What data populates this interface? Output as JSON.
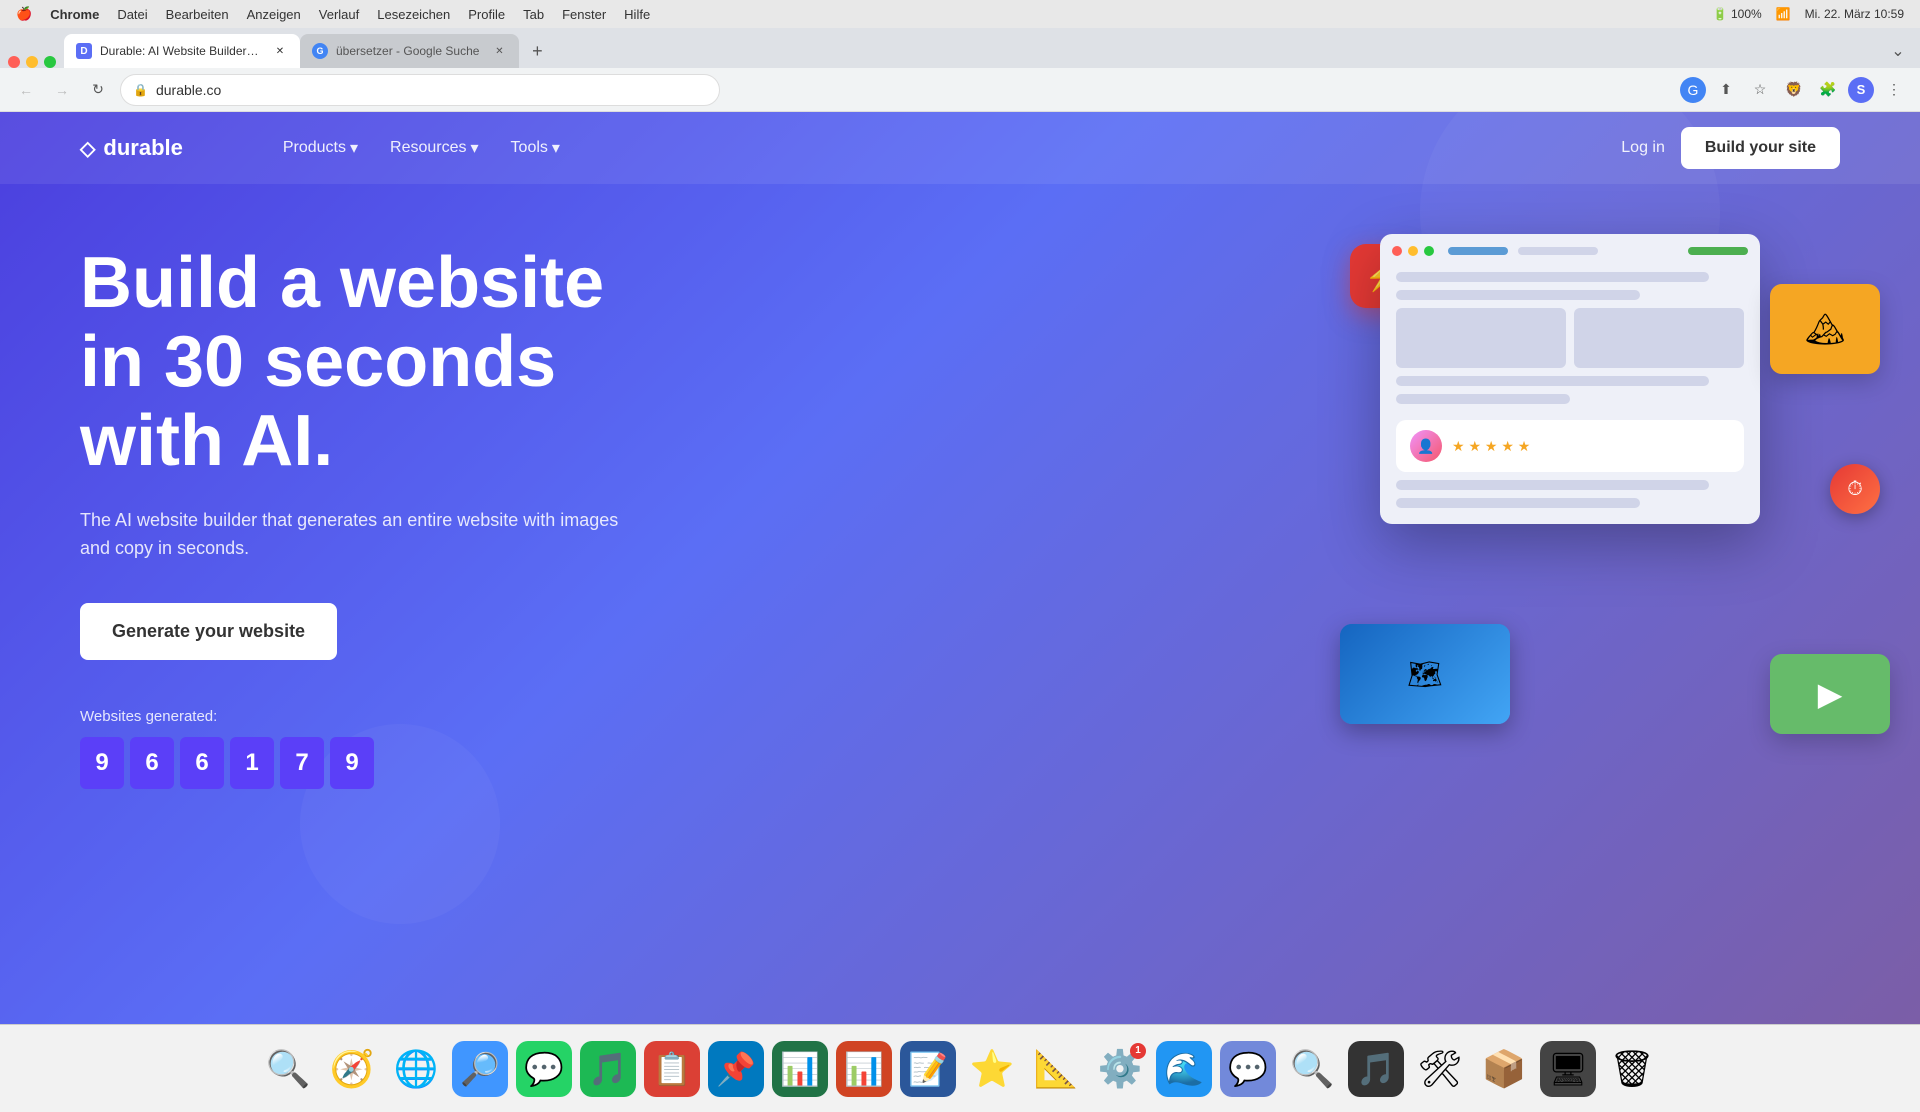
{
  "macos": {
    "apple": "🍎",
    "menu_items": [
      "Chrome",
      "Datei",
      "Bearbeiten",
      "Anzeigen",
      "Verlauf",
      "Lesezeichen",
      "Profile",
      "Tab",
      "Fenster",
      "Hilfe"
    ],
    "time": "Mi. 22. März  10:59"
  },
  "browser": {
    "tabs": [
      {
        "title": "Durable: AI Website Builder a...",
        "url": "durable.co",
        "active": true
      },
      {
        "title": "übersetzer - Google Suche",
        "url": "google.com",
        "active": false
      }
    ],
    "address": "durable.co"
  },
  "site": {
    "logo": "durable",
    "nav": {
      "products_label": "Products",
      "resources_label": "Resources",
      "tools_label": "Tools",
      "login_label": "Log in",
      "build_label": "Build your site"
    },
    "hero": {
      "title_line1": "Build a website",
      "title_line2": "in 30 seconds",
      "title_line3": "with AI.",
      "subtitle": "The AI website builder that generates an entire website with images and copy in seconds.",
      "cta": "Generate your website",
      "wg_label": "Websites generated:",
      "wg_digits": [
        "9",
        "6",
        "6",
        "1",
        "7",
        "9"
      ]
    }
  },
  "dock": {
    "items": [
      {
        "emoji": "🔍",
        "name": "finder",
        "bg": "#fff"
      },
      {
        "emoji": "🧭",
        "name": "safari",
        "bg": "#fff"
      },
      {
        "emoji": "🌐",
        "name": "chrome",
        "bg": "#fff"
      },
      {
        "emoji": "🔎",
        "name": "zoom",
        "bg": "#4096ff"
      },
      {
        "emoji": "💬",
        "name": "whatsapp",
        "bg": "#25d366"
      },
      {
        "emoji": "🎵",
        "name": "spotify",
        "bg": "#1db954"
      },
      {
        "emoji": "📋",
        "name": "todoist",
        "bg": "#db4035"
      },
      {
        "emoji": "📌",
        "name": "trello",
        "bg": "#0079bf"
      },
      {
        "emoji": "📊",
        "name": "excel",
        "bg": "#217346"
      },
      {
        "emoji": "📊",
        "name": "powerpoint",
        "bg": "#d04423"
      },
      {
        "emoji": "📝",
        "name": "word",
        "bg": "#2b579a"
      },
      {
        "emoji": "⭐",
        "name": "reeder",
        "bg": "#ff6b35"
      },
      {
        "emoji": "📐",
        "name": "googledrive",
        "bg": "#fff"
      },
      {
        "emoji": "⚙️",
        "name": "sysprefs",
        "bg": "#999",
        "notification": "1"
      },
      {
        "emoji": "🌊",
        "name": "aqua",
        "bg": "#2196f3"
      },
      {
        "emoji": "💬",
        "name": "discord",
        "bg": "#7289da"
      },
      {
        "emoji": "🔍",
        "name": "proxyman",
        "bg": "#fff"
      },
      {
        "emoji": "🎵",
        "name": "soundwaves",
        "bg": "#333"
      },
      {
        "emoji": "🛠",
        "name": "airdrop",
        "bg": "#fff"
      },
      {
        "emoji": "📦",
        "name": "archive",
        "bg": "#888"
      },
      {
        "emoji": "🖥",
        "name": "controlcenter",
        "bg": "#333"
      },
      {
        "emoji": "🗑",
        "name": "trash",
        "bg": "#888"
      }
    ]
  }
}
